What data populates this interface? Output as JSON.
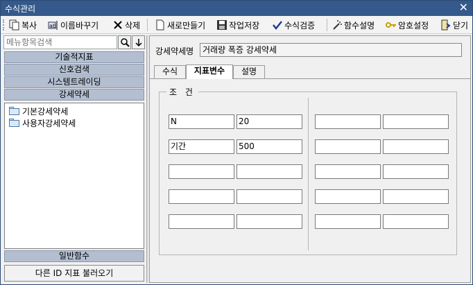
{
  "window": {
    "title": "수식관리",
    "close_glyph": "✕"
  },
  "toolbar": {
    "copy": "복사",
    "rename": "이름바꾸기",
    "delete": "삭제",
    "new": "새로만들기",
    "save": "작업저장",
    "validate": "수식검증",
    "func_help": "함수설명",
    "password": "암호설정",
    "close": "닫기"
  },
  "left": {
    "search_placeholder": "메뉴항목검색",
    "search_icon": "search-icon",
    "down_icon": "arrow-down-icon",
    "categories": [
      "기술적지표",
      "신호검색",
      "시스템트레이딩",
      "강세약세"
    ],
    "tree": [
      "기본강세약세",
      "사용자강세약세"
    ],
    "bottom_category": "일반함수",
    "load_button": "다른 ID 지표 불러오기"
  },
  "right": {
    "name_label": "강세약세명",
    "name_value": "거래량 폭증 강세약세",
    "tabs": [
      "수식",
      "지표변수",
      "설명"
    ],
    "active_tab": "지표변수",
    "group_label": "조 건",
    "conditions": [
      [
        "N",
        "20",
        "",
        ""
      ],
      [
        "기간",
        "500",
        "",
        ""
      ],
      [
        "",
        "",
        "",
        ""
      ],
      [
        "",
        "",
        "",
        ""
      ],
      [
        "",
        "",
        "",
        ""
      ]
    ]
  },
  "colors": {
    "titlebar": "#34598a",
    "category": "#b3bfd1"
  }
}
